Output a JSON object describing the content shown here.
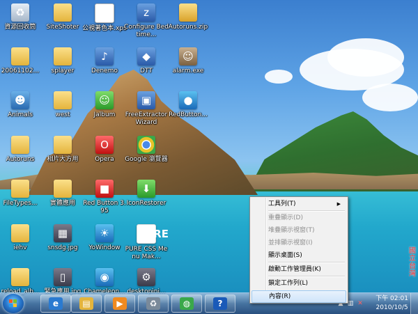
{
  "desktop": {
    "icons": [
      {
        "label": "資源回收筒",
        "icon": "recycle-bin-icon",
        "glyph": "♻"
      },
      {
        "label": "SiteShoter",
        "icon": "folder-icon",
        "glyph": ""
      },
      {
        "label": "公視著色本.xps",
        "icon": "xps-document-icon",
        "glyph": "≡"
      },
      {
        "label": "Configure Bedtime...",
        "icon": "shortcut-icon",
        "glyph": "z"
      },
      {
        "label": "Autoruns.zip",
        "icon": "zip-folder-icon",
        "glyph": ""
      },
      {
        "label": "20061102...",
        "icon": "folder-icon",
        "glyph": ""
      },
      {
        "label": "splayer",
        "icon": "folder-icon",
        "glyph": ""
      },
      {
        "label": "Denemo",
        "icon": "music-app-icon",
        "glyph": "♪"
      },
      {
        "label": "DTT",
        "icon": "app-icon",
        "glyph": "◆"
      },
      {
        "label": "alarm.exe",
        "icon": "cat-app-icon",
        "glyph": "☺"
      },
      {
        "label": "Animals",
        "icon": "people-icon",
        "glyph": "☻"
      },
      {
        "label": "west",
        "icon": "folder-icon",
        "glyph": ""
      },
      {
        "label": "Jalbum",
        "icon": "frog-app-icon",
        "glyph": "☺"
      },
      {
        "label": "FreeExtractor Wizard",
        "icon": "extractor-icon",
        "glyph": "▣"
      },
      {
        "label": "RedButton...",
        "icon": "globe-icon",
        "glyph": "●"
      },
      {
        "label": "Autoruns",
        "icon": "folder-icon",
        "glyph": ""
      },
      {
        "label": "相片大方用",
        "icon": "folder-icon",
        "glyph": ""
      },
      {
        "label": "Opera",
        "icon": "opera-icon",
        "glyph": "O"
      },
      {
        "label": "Google 瀏覽器",
        "icon": "chrome-icon",
        "glyph": ""
      },
      {
        "label": "FileTypes...",
        "icon": "folder-icon",
        "glyph": ""
      },
      {
        "label": "實體應用",
        "icon": "folder-icon",
        "glyph": ""
      },
      {
        "label": "Red Button 3.95",
        "icon": "red-button-icon",
        "glyph": "■"
      },
      {
        "label": "IconRestorer",
        "icon": "download-icon",
        "glyph": "⬇"
      },
      {
        "label": "iehv",
        "icon": "folder-icon",
        "glyph": ""
      },
      {
        "label": "snsdg.jpg",
        "icon": "image-icon",
        "glyph": "▦"
      },
      {
        "label": "YoWindow",
        "icon": "weather-icon",
        "glyph": "☀"
      },
      {
        "label": "PURE CSS Menu Mak...",
        "icon": "pure-css-icon",
        "glyph": "PURE"
      },
      {
        "label": "reload_alb...",
        "icon": "folder-icon",
        "glyph": ""
      },
      {
        "label": "緊急應用.jpg",
        "icon": "image-icon",
        "glyph": "▯"
      },
      {
        "label": "Chameleon...",
        "icon": "chameleon-icon",
        "glyph": "◉"
      },
      {
        "label": "desktopini...",
        "icon": "settings-file-icon",
        "glyph": "⚙"
      }
    ],
    "side_text": "國立台灣"
  },
  "taskbar": {
    "start_label": "",
    "pinned": [
      {
        "name": "internet-explorer-icon",
        "glyph": "e",
        "color": "#2a7ad0"
      },
      {
        "name": "windows-explorer-icon",
        "glyph": "▤",
        "color": "#e4b43c"
      },
      {
        "name": "media-player-icon",
        "glyph": "▶",
        "color": "#f08a20"
      },
      {
        "name": "recycle-app-icon",
        "glyph": "♻",
        "color": "#7a8a9a"
      },
      {
        "name": "chrome-icon",
        "glyph": "◍",
        "color": "#3aa84a"
      },
      {
        "name": "help-icon",
        "glyph": "?",
        "color": "#1a5ab8"
      }
    ],
    "clock": {
      "time": "下午 02:01",
      "date": "2010/10/5"
    }
  },
  "context_menu": {
    "items": [
      {
        "label": "工具列(T)",
        "enabled": true,
        "submenu": true
      },
      {
        "label": "重疊顯示(D)",
        "enabled": false
      },
      {
        "label": "堆疊顯示視窗(T)",
        "enabled": false
      },
      {
        "label": "並排顯示視窗(I)",
        "enabled": false
      },
      {
        "label": "顯示桌面(S)",
        "enabled": true
      },
      {
        "label": "啟動工作管理員(K)",
        "enabled": true
      },
      {
        "label": "鎖定工作列(L)",
        "enabled": true
      },
      {
        "label": "內容(R)",
        "enabled": true,
        "highlighted": true
      }
    ]
  }
}
